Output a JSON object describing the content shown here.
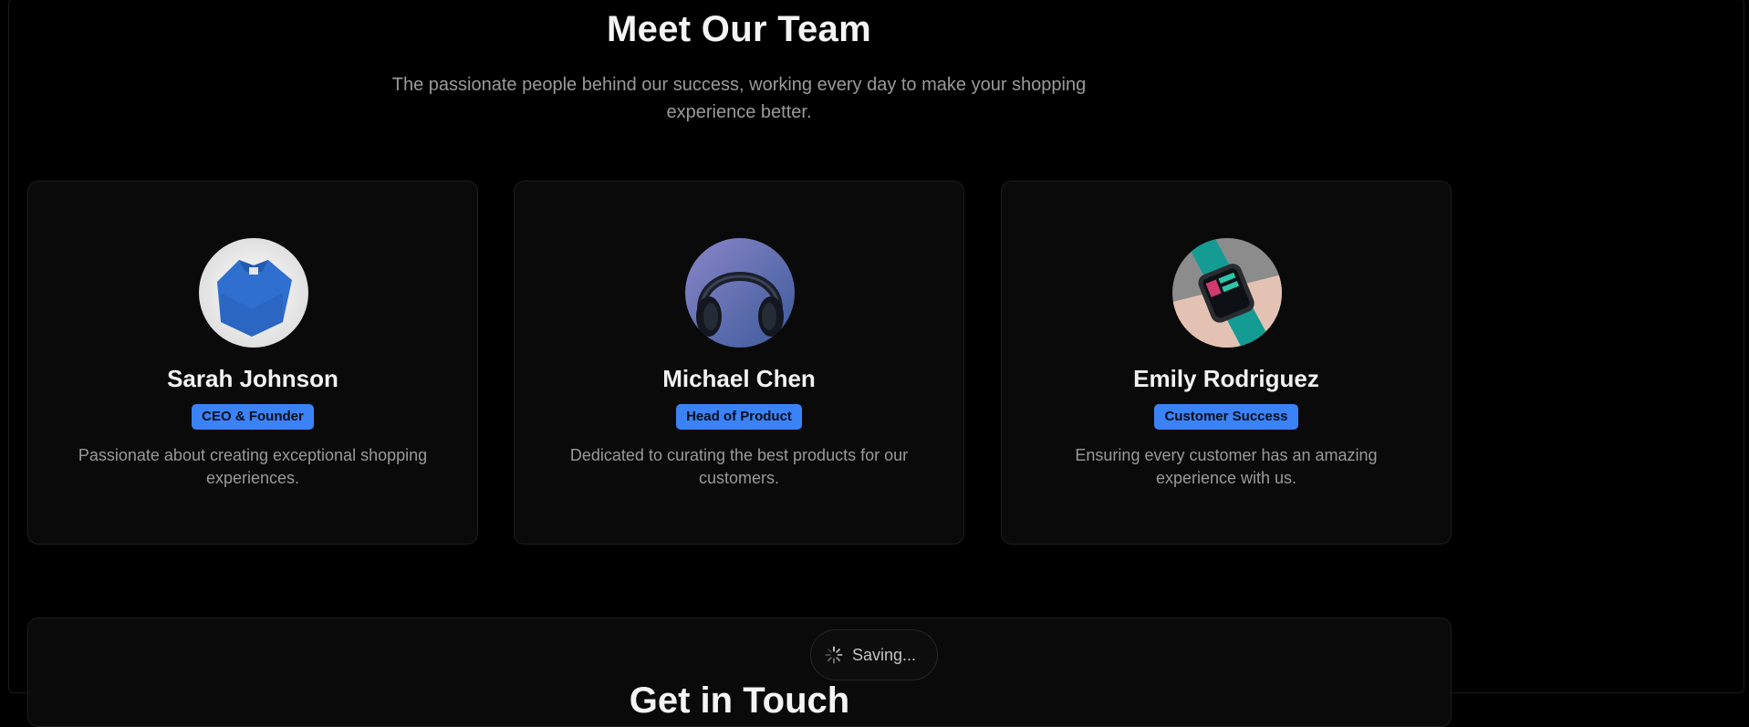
{
  "team": {
    "title": "Meet Our Team",
    "subtitle": "The passionate people behind our success, working every day to make your shopping experience better.",
    "members": [
      {
        "name": "Sarah Johnson",
        "role": "CEO & Founder",
        "bio": "Passionate about creating exceptional shopping experiences.",
        "photo_icon": "blue-tshirt-photo",
        "badge_color": "#3b82f6"
      },
      {
        "name": "Michael Chen",
        "role": "Head of Product",
        "bio": "Dedicated to curating the best products for our customers.",
        "photo_icon": "headphones-photo",
        "badge_color": "#3b82f6"
      },
      {
        "name": "Emily Rodriguez",
        "role": "Customer Success",
        "bio": "Ensuring every customer has an amazing experience with us.",
        "photo_icon": "smartwatch-photo",
        "badge_color": "#3b82f6"
      }
    ]
  },
  "next_section": {
    "title": "Get in Touch"
  },
  "status": {
    "saving_label": "Saving...",
    "icon": "spinner-icon"
  },
  "colors": {
    "background": "#000000",
    "card": "#0a0a0a",
    "accent": "#3b82f6",
    "muted_text": "#9a9a9a"
  }
}
